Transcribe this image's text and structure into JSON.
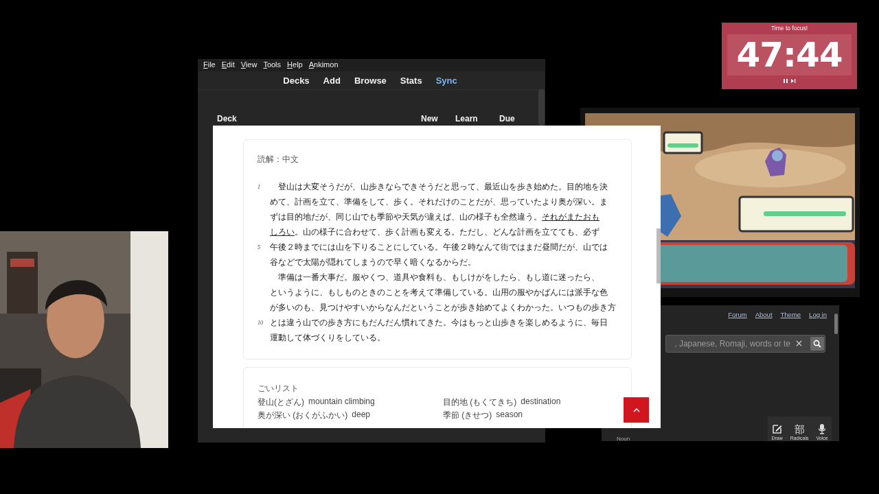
{
  "timer": {
    "caption": "Time to focus!",
    "time": "47:44"
  },
  "anki": {
    "menu": [
      "File",
      "Edit",
      "View",
      "Tools",
      "Help",
      "Ankimon"
    ],
    "toolbar": [
      {
        "label": "Decks",
        "highlighted": false
      },
      {
        "label": "Add",
        "highlighted": false
      },
      {
        "label": "Browse",
        "highlighted": false
      },
      {
        "label": "Stats",
        "highlighted": false
      },
      {
        "label": "Sync",
        "highlighted": true
      }
    ],
    "deck_columns": [
      "Deck",
      "New",
      "Learn",
      "Due"
    ]
  },
  "dictionary": {
    "links": [
      "Forum",
      "About",
      "Theme",
      "Log in"
    ],
    "search": {
      "placeholder": ", Japanese, Romaji, words or te"
    },
    "tools": [
      {
        "kind": "draw",
        "label": "Draw"
      },
      {
        "kind": "radicals",
        "label": "Radicals",
        "glyph": "部"
      },
      {
        "kind": "voice",
        "label": "Voice"
      }
    ],
    "footer": "Noun"
  },
  "card": {
    "section_title": "読解：中文",
    "lines": [
      {
        "number": "1",
        "parts": [
          {
            "text": "　登山は大変そうだが、山歩きならできそうだと思って、最近山を歩き始めた。目的地を決",
            "underlined": false
          }
        ]
      },
      {
        "parts": [
          {
            "text": "めて、計画を立て、準備をして、歩く。それだけのことだが、思っていたより奥が深い。ま",
            "underlined": false
          }
        ]
      },
      {
        "parts": [
          {
            "text": "ずは目的地だが、同じ山でも季節や天気が違えば、山の様子も全然違う。",
            "underlined": false
          },
          {
            "text": "それがまたおも",
            "underlined": true
          }
        ]
      },
      {
        "parts": [
          {
            "text": "しろい",
            "underlined": true
          },
          {
            "text": "。山の様子に合わせて、歩く計画も変える。ただし、どんな計画を立てても、必ず",
            "underlined": false
          }
        ]
      },
      {
        "number": "5",
        "parts": [
          {
            "text": "午後２時までには山を下りることにしている。午後２時なんて街ではまだ昼間だが、山では",
            "underlined": false
          }
        ]
      },
      {
        "parts": [
          {
            "text": "谷などで太陽が隠れてしまうので早く暗くなるからだ。",
            "underlined": false
          }
        ]
      },
      {
        "parts": [
          {
            "text": "　準備は一番大事だ。服やくつ、道具や食料も、もしけがをしたら、もし道に迷ったら、",
            "underlined": false
          }
        ]
      },
      {
        "parts": [
          {
            "text": "というように、もしものときのことを考えて準備している。山用の服やかばんには派手な色",
            "underlined": false
          }
        ]
      },
      {
        "parts": [
          {
            "text": "が多いのも、見つけやすいからなんだということが歩き始めてよくわかった。いつもの歩き方",
            "underlined": false
          }
        ]
      },
      {
        "number": "10",
        "parts": [
          {
            "text": "とは違う山での歩き方にもだんだん慣れてきた。今はもっと山歩きを楽しめるように、毎日",
            "underlined": false
          }
        ]
      },
      {
        "parts": [
          {
            "text": "運動して体づくりをしている。",
            "underlined": false
          }
        ]
      }
    ],
    "vocab_title": "ごいリスト",
    "vocab": [
      {
        "term": "登山(とざん)",
        "meaning": "mountain climbing"
      },
      {
        "term": "目的地 (もくてきち)",
        "meaning": "destination"
      },
      {
        "term": "奥が深い (おくがふかい)",
        "meaning": "deep"
      },
      {
        "term": "季節 (きせつ)",
        "meaning": "season"
      }
    ]
  }
}
